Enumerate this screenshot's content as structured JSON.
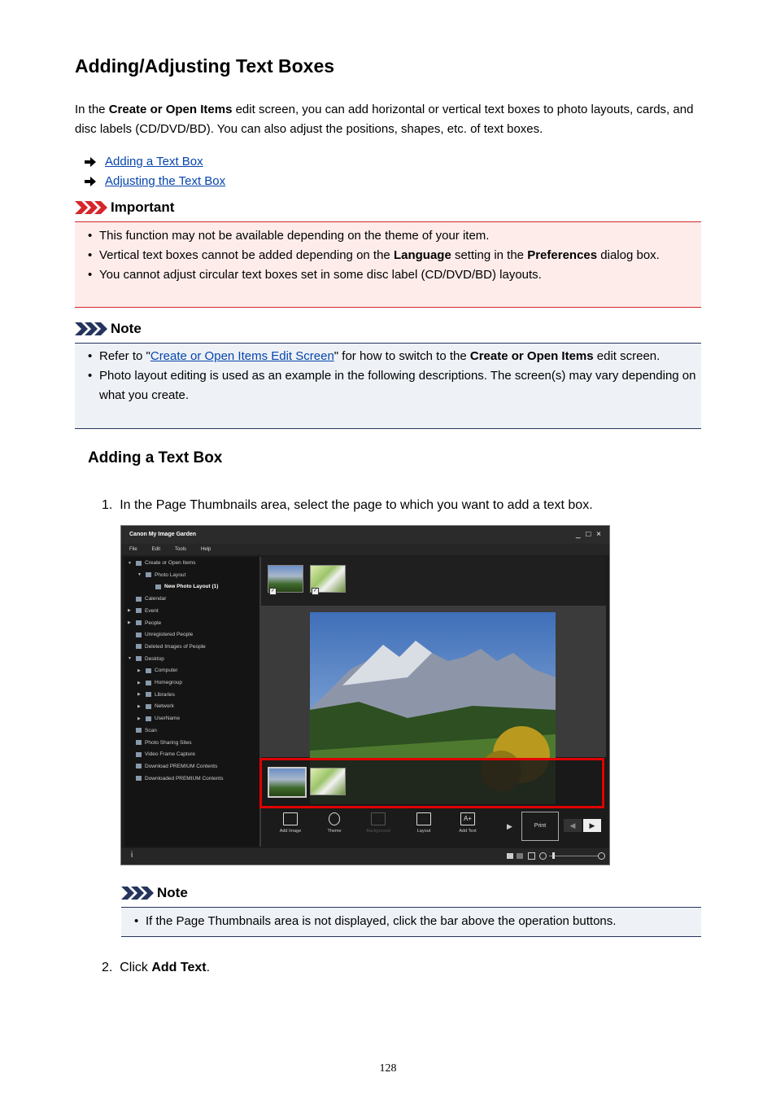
{
  "title": "Adding/Adjusting Text Boxes",
  "intro": {
    "p1": "In the ",
    "b1": "Create or Open Items",
    "p2": " edit screen, you can add horizontal or vertical text boxes to photo layouts, cards, and disc labels (CD/DVD/BD). You can also adjust the positions, shapes, etc. of text boxes."
  },
  "links": [
    "Adding a Text Box",
    "Adjusting the Text Box"
  ],
  "important": {
    "heading": "Important",
    "item1": "This function may not be available depending on the theme of your item.",
    "item2_a": "Vertical text boxes cannot be added depending on the ",
    "item2_b1": "Language",
    "item2_c": " setting in the ",
    "item2_b2": "Preferences",
    "item2_d": " dialog box.",
    "item3": "You cannot adjust circular text boxes set in some disc label (CD/DVD/BD) layouts."
  },
  "note1": {
    "heading": "Note",
    "item1_a": "Refer to \"",
    "item1_link": "Create or Open Items Edit Screen",
    "item1_b": "\" for how to switch to the ",
    "item1_bold": "Create or Open Items",
    "item1_c": " edit screen.",
    "item2": "Photo layout editing is used as an example in the following descriptions. The screen(s) may vary depending on what you create."
  },
  "section_heading": "Adding a Text Box",
  "step1": {
    "num": "1.",
    "text": "In the Page Thumbnails area, select the page to which you want to add a text box."
  },
  "screenshot": {
    "app_title": "Canon My Image Garden",
    "window_controls": "_ □ ×",
    "menu": [
      "File",
      "Edit",
      "Tools",
      "Help"
    ],
    "tree": [
      {
        "label": "Create or Open Items",
        "indent": 0,
        "toggle": "▼"
      },
      {
        "label": "Photo Layout",
        "indent": 1,
        "toggle": "▼"
      },
      {
        "label": "New Photo Layout (1)",
        "indent": 2,
        "toggle": ""
      },
      {
        "label": "Calendar",
        "indent": 0,
        "toggle": ""
      },
      {
        "label": "Event",
        "indent": 0,
        "toggle": "▶"
      },
      {
        "label": "People",
        "indent": 0,
        "toggle": "▶"
      },
      {
        "label": "Unregistered People",
        "indent": 0,
        "toggle": ""
      },
      {
        "label": "Deleted Images of People",
        "indent": 0,
        "toggle": ""
      },
      {
        "label": "Desktop",
        "indent": 0,
        "toggle": "▼"
      },
      {
        "label": "Computer",
        "indent": 1,
        "toggle": "▶"
      },
      {
        "label": "Homegroup",
        "indent": 1,
        "toggle": "▶"
      },
      {
        "label": "Libraries",
        "indent": 1,
        "toggle": "▶"
      },
      {
        "label": "Network",
        "indent": 1,
        "toggle": "▶"
      },
      {
        "label": "UserName",
        "indent": 1,
        "toggle": "▶"
      },
      {
        "label": "Scan",
        "indent": 0,
        "toggle": ""
      },
      {
        "label": "Photo Sharing Sites",
        "indent": 0,
        "toggle": ""
      },
      {
        "label": "Video Frame Capture",
        "indent": 0,
        "toggle": ""
      },
      {
        "label": "Download PREMIUM Contents",
        "indent": 0,
        "toggle": ""
      },
      {
        "label": "Downloaded PREMIUM Contents",
        "indent": 0,
        "toggle": ""
      }
    ],
    "ops": [
      "Add Image",
      "Theme",
      "Background",
      "Layout",
      "Add Text"
    ],
    "print": "Print",
    "info": "i",
    "highlight_color": "#e00000"
  },
  "note2": {
    "heading": "Note",
    "item1": "If the Page Thumbnails area is not displayed, click the bar above the operation buttons."
  },
  "step2": {
    "num": "2.",
    "text": "Click ",
    "bold": "Add Text",
    "end": "."
  },
  "page_number": "128"
}
